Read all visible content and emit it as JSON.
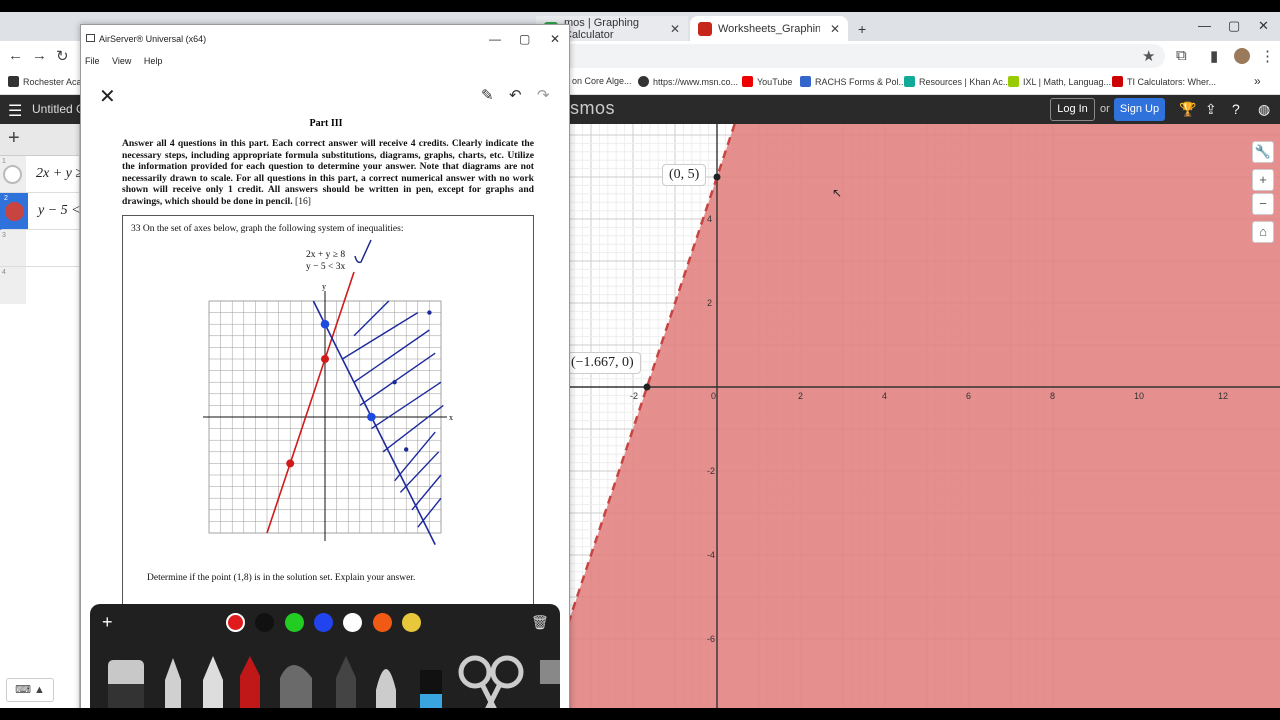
{
  "browser": {
    "tabs": [
      {
        "label": "mos | Graphing Calculator",
        "close": "✕",
        "fav_color": "#2fa84f"
      },
      {
        "label": "Worksheets_GraphingOnTheC",
        "close": "✕",
        "fav_color": "#c7271a"
      }
    ],
    "new_tab": "+",
    "window_controls": [
      "—",
      "▢",
      "✕"
    ],
    "nav": [
      "←",
      "→",
      "↻"
    ],
    "bookmarks": [
      {
        "label": "Rochester Acade",
        "color": "#333"
      },
      {
        "label": "on Core Alge...",
        "color": "#888"
      },
      {
        "label": "https://www.msn.co...",
        "color": "#333"
      },
      {
        "label": "YouTube",
        "color": "#e00"
      },
      {
        "label": "RACHS Forms & Pol...",
        "color": "#36c"
      },
      {
        "label": "Resources | Khan Ac...",
        "color": "#1a9"
      },
      {
        "label": "IXL | Math, Languag...",
        "color": "#9c0"
      },
      {
        "label": "TI Calculators: Wher...",
        "color": "#c00"
      }
    ],
    "overflow": "»"
  },
  "desmos": {
    "title": "Untitled G",
    "brand": "smos",
    "login": "Log In",
    "or": "or",
    "signup": "Sign Up",
    "add": "+",
    "expressions": [
      {
        "index": "1",
        "text": "2x + y ≥"
      },
      {
        "index": "2",
        "text": "y − 5 <"
      },
      {
        "index": "3",
        "text": ""
      },
      {
        "index": "4",
        "text": ""
      }
    ],
    "keyboard": "⌨ ▲",
    "graph": {
      "shade_color": "#e07b7b",
      "boundary_color": "#c74440",
      "point_labels": [
        "(0, 5)",
        "(−1.667, 0)"
      ],
      "x_ticks": [
        "-2",
        "0",
        "2",
        "4",
        "6",
        "8",
        "10",
        "12"
      ],
      "y_ticks": [
        "4",
        "2",
        "-2",
        "-4",
        "-6"
      ],
      "buttons": [
        "🔧",
        "+",
        "−",
        "⌂"
      ]
    }
  },
  "airserver": {
    "title": "AirServer® Universal (x64)",
    "menu": [
      "File",
      "View",
      "Help"
    ],
    "window_controls": [
      "—",
      "▢",
      "✕"
    ],
    "doc_close": "✕",
    "doc_tools": [
      "✎",
      "↶",
      "↷"
    ],
    "part": "Part III",
    "instructions": "Answer all 4 questions in this part. Each correct answer will receive 4 credits. Clearly indicate the necessary steps, including appropriate formula substitutions, diagrams, graphs, charts, etc. Utilize the information provided for each question to determine your answer. Note that diagrams are not necessarily drawn to scale. For all questions in this part, a correct numerical answer with no work shown will receive only 1 credit. All answers should be written in pen, except for graphs and drawings, which should be done in pencil.",
    "credits": "[16]",
    "question": "33  On the set of axes below, graph the following system of inequalities:",
    "inequality1": "2x + y ≥ 8",
    "inequality2": "y − 5 < 3x",
    "axis_x": "x",
    "axis_y": "y",
    "determine": "Determine if the point (1,8) is in the solution set. Explain your answer."
  },
  "toolbar": {
    "add": "+",
    "trash": "🗑",
    "colors": [
      "#e01b1b",
      "#111111",
      "#22cc22",
      "#2244ee",
      "#ffffff",
      "#f05a14",
      "#e8c73a"
    ]
  }
}
